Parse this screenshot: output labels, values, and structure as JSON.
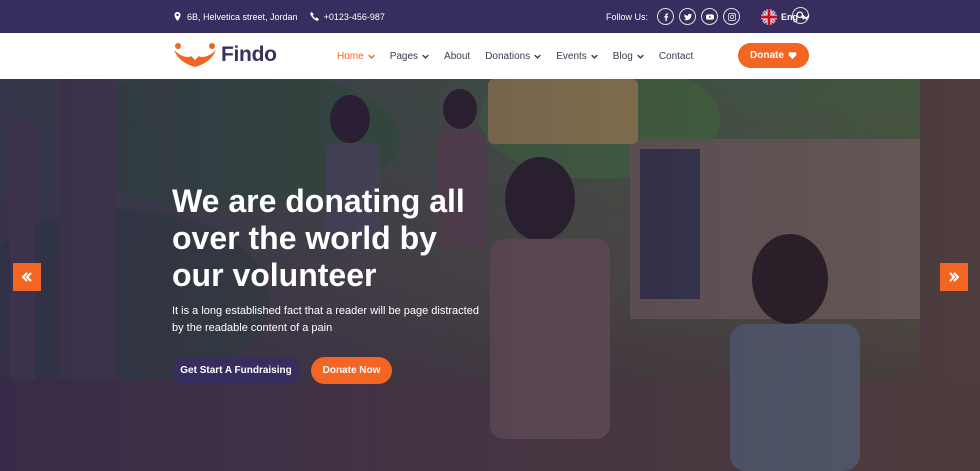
{
  "topbar": {
    "address": "6B, Helvetica street, Jordan",
    "phone": "+0123-456-987",
    "follow_label": "Follow Us:",
    "social_icons": [
      "facebook-icon",
      "twitter-icon",
      "youtube-icon",
      "instagram-icon"
    ],
    "language": "Eng"
  },
  "nav": {
    "brand": "Findo",
    "items": [
      {
        "label": "Home",
        "dropdown": true,
        "active": true
      },
      {
        "label": "Pages",
        "dropdown": true,
        "active": false
      },
      {
        "label": "About",
        "dropdown": false,
        "active": false
      },
      {
        "label": "Donations",
        "dropdown": true,
        "active": false
      },
      {
        "label": "Events",
        "dropdown": true,
        "active": false
      },
      {
        "label": "Blog",
        "dropdown": true,
        "active": false
      },
      {
        "label": "Contact",
        "dropdown": false,
        "active": false
      }
    ],
    "donate_label": "Donate"
  },
  "hero": {
    "title_lines": [
      "We are donating all",
      "over the world by",
      "our volunteer"
    ],
    "text": "It is a long established fact that a reader will be page distracted by the readable content of a pain",
    "primary_button": "Get Start A Fundraising",
    "secondary_button": "Donate Now"
  },
  "colors": {
    "accent": "#f26522",
    "dark": "#372d5e"
  }
}
